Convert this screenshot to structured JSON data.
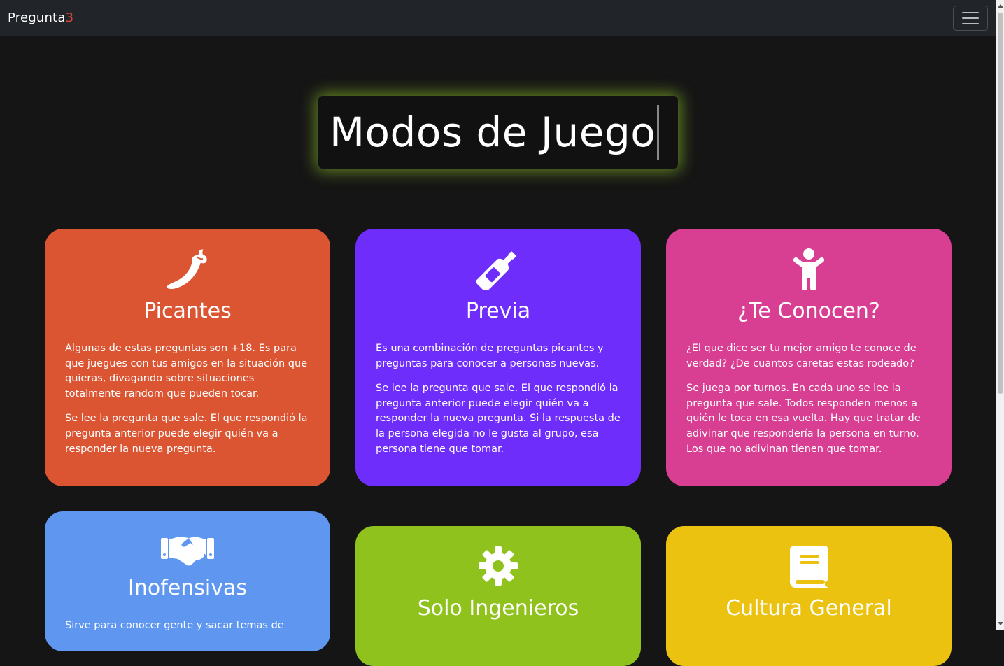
{
  "navbar": {
    "brand_main": "Pregunta",
    "brand_accent": "3"
  },
  "hero": {
    "title": "Modos de Juego"
  },
  "modes": [
    {
      "title": "Picantes",
      "icon": "pepper-icon",
      "color": "#db5533",
      "description": "Algunas de estas preguntas son +18. Es para que juegues con tus amigos en la situación que quieras, divagando sobre situaciones totalmente random que pueden tocar.",
      "rules": "Se lee la pregunta que sale. El que respondió la pregunta anterior puede elegir quién va a responder la nueva pregunta."
    },
    {
      "title": "Previa",
      "icon": "bottle-icon",
      "color": "#6f2dfb",
      "description": "Es una combinación de preguntas picantes y preguntas para conocer a personas nuevas.",
      "rules": "Se lee la pregunta que sale. El que respondió la pregunta anterior puede elegir quién va a responder la nueva pregunta. Si la respuesta de la persona elegida no le gusta al grupo, esa persona tiene que tomar."
    },
    {
      "title": "¿Te Conocen?",
      "icon": "person-icon",
      "color": "#d83f93",
      "description": "¿El que dice ser tu mejor amigo te conoce de verdad? ¿De cuantos caretas estas rodeado?",
      "rules": "Se juega por turnos. En cada uno se lee la pregunta que sale. Todos responden menos a quién le toca en esa vuelta. Hay que tratar de adivinar que respondería la persona en turno. Los que no adivinan tienen que tomar."
    },
    {
      "title": "Inofensivas",
      "icon": "handshake-icon",
      "color": "#5f97f0",
      "description": "Sirve para conocer gente y sacar temas de"
    },
    {
      "title": "Solo Ingenieros",
      "icon": "gear-icon",
      "color": "#8fc21c"
    },
    {
      "title": "Cultura General",
      "icon": "book-icon",
      "color": "#ecc211"
    }
  ]
}
